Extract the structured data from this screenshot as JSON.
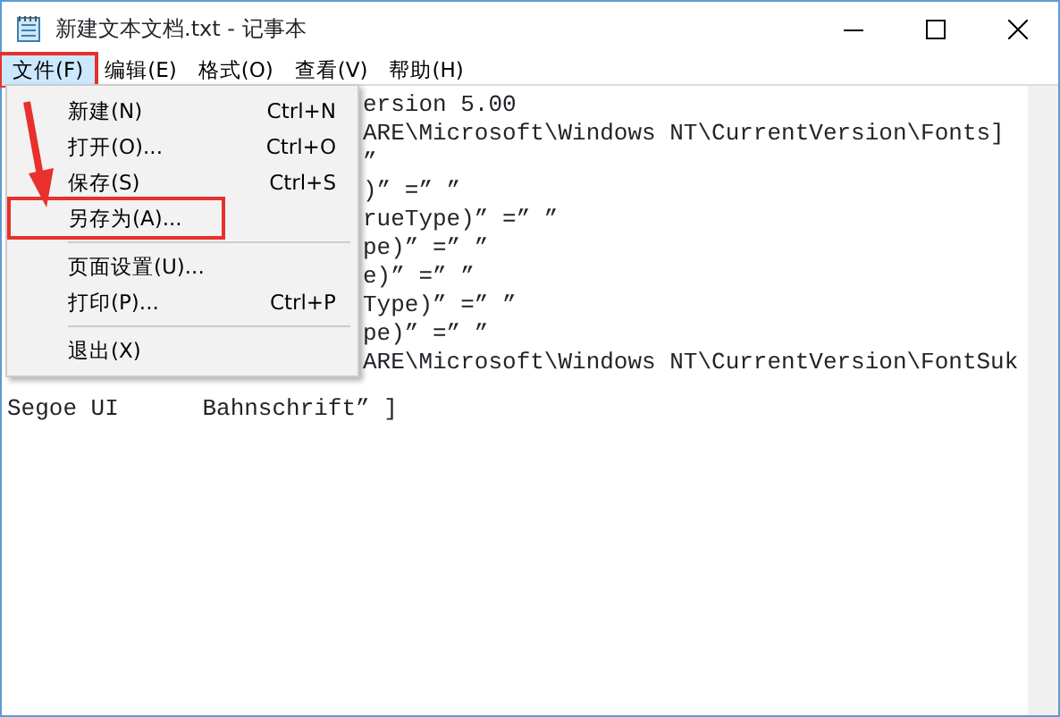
{
  "window": {
    "title": "新建文本文档.txt - 记事本"
  },
  "menubar": [
    {
      "label": "文件(F)",
      "selected": true,
      "annotated": true
    },
    {
      "label": "编辑(E)",
      "selected": false,
      "annotated": false
    },
    {
      "label": "格式(O)",
      "selected": false,
      "annotated": false
    },
    {
      "label": "查看(V)",
      "selected": false,
      "annotated": false
    },
    {
      "label": "帮助(H)",
      "selected": false,
      "annotated": false
    }
  ],
  "file_menu": [
    {
      "kind": "item",
      "label": "新建(N)",
      "shortcut": "Ctrl+N",
      "annotated": false
    },
    {
      "kind": "item",
      "label": "打开(O)...",
      "shortcut": "Ctrl+O",
      "annotated": false
    },
    {
      "kind": "item",
      "label": "保存(S)",
      "shortcut": "Ctrl+S",
      "annotated": false
    },
    {
      "kind": "item",
      "label": "另存为(A)...",
      "annotated": true
    },
    {
      "kind": "separator"
    },
    {
      "kind": "item",
      "label": "页面设置(U)..."
    },
    {
      "kind": "item",
      "label": "打印(P)...",
      "shortcut": "Ctrl+P",
      "annotated": false
    },
    {
      "kind": "separator"
    },
    {
      "kind": "item",
      "label": "退出(X)",
      "annotated": false
    }
  ],
  "editor": {
    "lines_beside_menu": [
      "ersion 5.00",
      "ARE\\Microsoft\\Windows NT\\CurrentVersion\\Fonts]",
      "”",
      ")” =” ”",
      "rueType)” =” ”",
      "pe)” =” ”",
      "e)” =” ”",
      "Type)” =” ”",
      "pe)” =” ”",
      "ARE\\Microsoft\\Windows NT\\CurrentVersion\\FontSuk"
    ],
    "last_line": "Segoe UI      Bahnschrift” ]"
  }
}
